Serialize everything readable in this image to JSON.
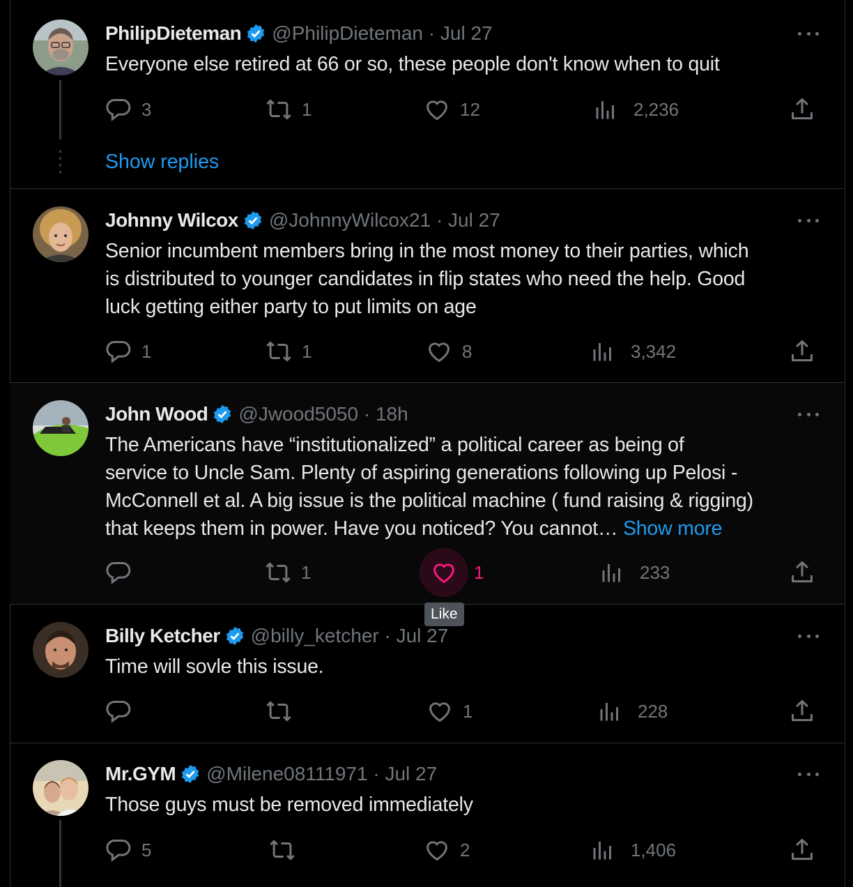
{
  "colors": {
    "background": "#000000",
    "text": "#e7e9ea",
    "muted": "#71767b",
    "link": "#1d9bf0",
    "like_active": "#f91880",
    "verified": "#1d9bf0",
    "divider": "#2f3336"
  },
  "tweets": [
    {
      "name": "PhilipDieteman",
      "handle_time": "@PhilipDieteman · Jul 27",
      "text": "Everyone else retired at 66 or so, these people don't know when to quit",
      "replies": "3",
      "retweets": "1",
      "likes": "12",
      "views": "2,236",
      "show_replies": "Show replies"
    },
    {
      "name": "Johnny Wilcox",
      "handle_time": "@JohnnyWilcox21 · Jul 27",
      "text_lines": [
        "Senior incumbent members bring in the most money to their parties, which",
        "is distributed to younger candidates in flip states who need the help. Good",
        "luck getting either party to put limits on age"
      ],
      "replies": "1",
      "retweets": "1",
      "likes": "8",
      "views": "3,342"
    },
    {
      "name": "John Wood",
      "handle_time": "@Jwood5050 · 18h",
      "text_lines": [
        "The Americans have “institutionalized” a political career as being of",
        "service to Uncle Sam. Plenty of aspiring generations following up Pelosi -",
        "McConnell et al. A big issue is the political machine ( fund raising & rigging)",
        "that keeps them in power. Have you noticed? You cannot… "
      ],
      "show_more": "Show more",
      "replies": "",
      "retweets": "1",
      "likes": "1",
      "views": "233",
      "like_tooltip": "Like"
    },
    {
      "name": "Billy Ketcher",
      "handle_time": "@billy_ketcher · Jul 27",
      "text": "Time will sovle this issue.",
      "replies": "",
      "retweets": "",
      "likes": "1",
      "views": "228"
    },
    {
      "name": "Mr.GYM",
      "handle_time": "@Milene08111971 · Jul 27",
      "text": "Those guys must be removed immediately",
      "replies": "5",
      "retweets": "",
      "likes": "2",
      "views": "1,406"
    }
  ],
  "icons": {
    "reply": "reply-icon",
    "retweet": "retweet-icon",
    "like": "heart-icon",
    "views": "views-icon",
    "share": "share-icon",
    "more": "more-icon",
    "verified": "verified-badge-icon"
  }
}
